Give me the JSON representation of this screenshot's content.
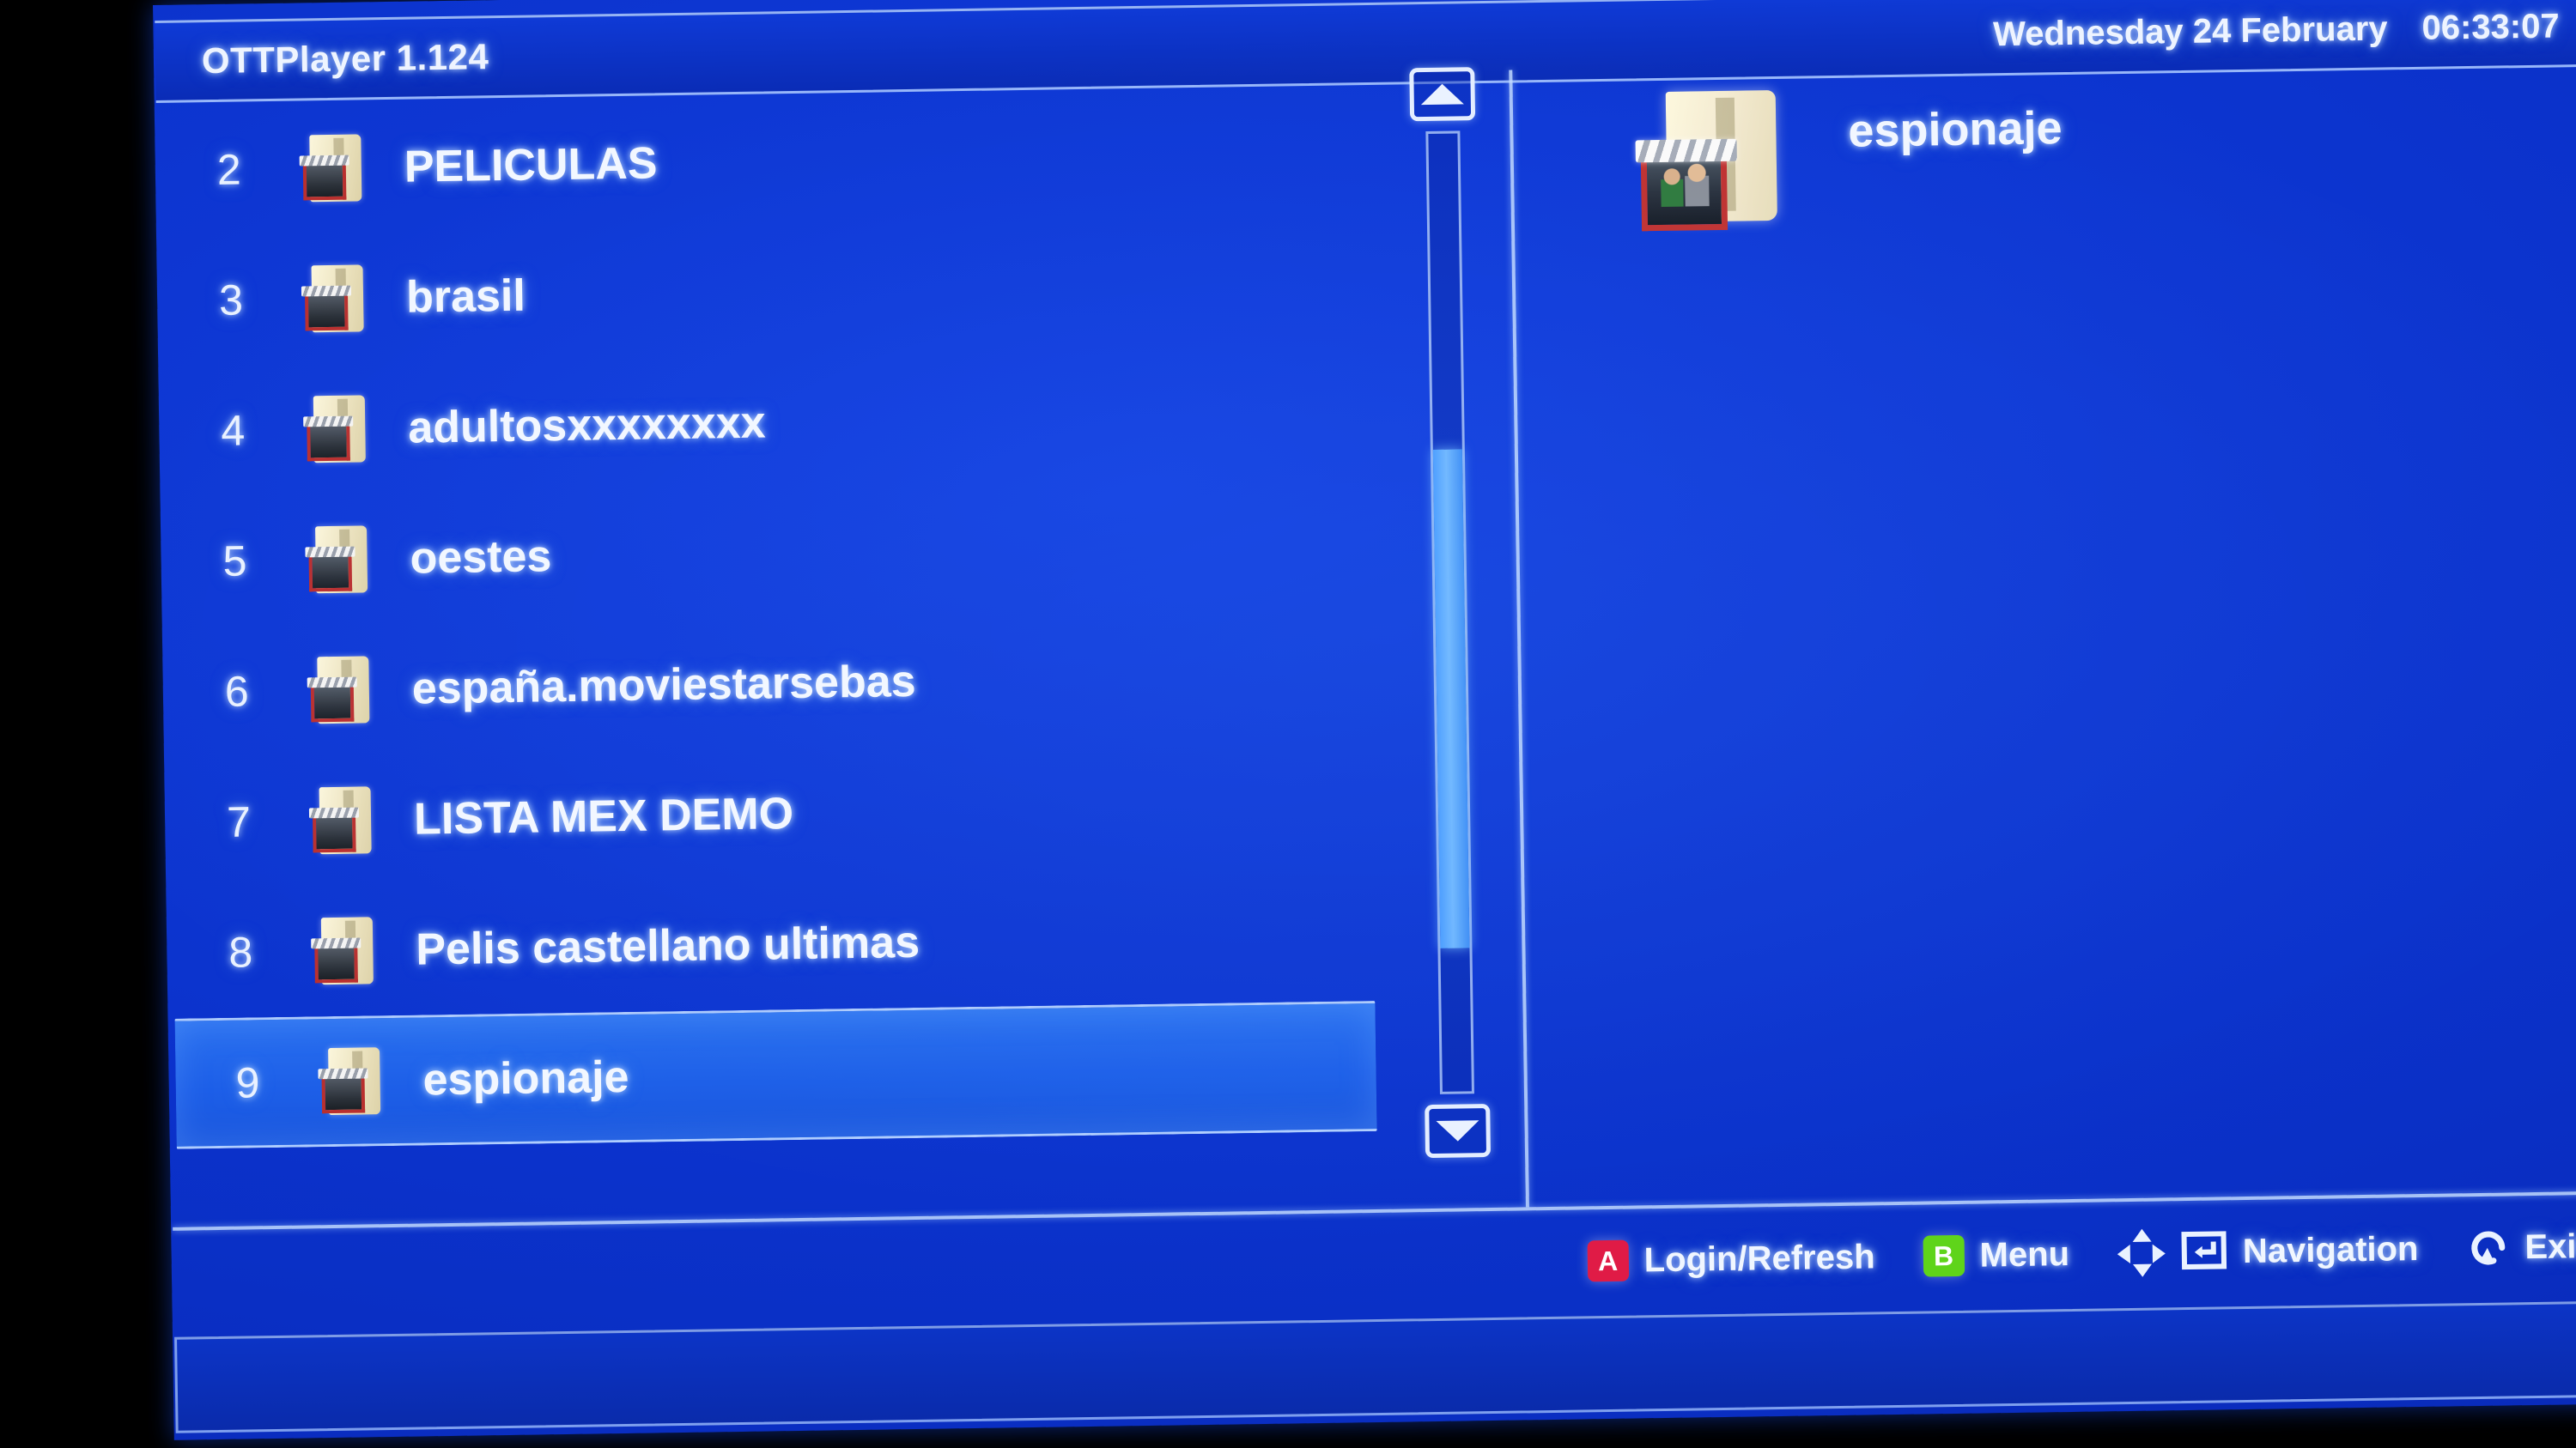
{
  "header": {
    "app_title": "OTTPlayer 1.124",
    "date": "Wednesday 24 February",
    "time": "06:33:07"
  },
  "list": {
    "items": [
      {
        "num": "2",
        "label": "PELICULAS",
        "icon": "folder-movie-icon",
        "selected": false
      },
      {
        "num": "3",
        "label": "brasil",
        "icon": "folder-movie-icon",
        "selected": false
      },
      {
        "num": "4",
        "label": "adultosxxxxxxxx",
        "icon": "folder-movie-icon",
        "selected": false
      },
      {
        "num": "5",
        "label": "oestes",
        "icon": "folder-movie-icon",
        "selected": false
      },
      {
        "num": "6",
        "label": "españa.moviestarsebas",
        "icon": "folder-movie-icon",
        "selected": false
      },
      {
        "num": "7",
        "label": "LISTA MEX DEMO",
        "icon": "folder-movie-icon",
        "selected": false
      },
      {
        "num": "8",
        "label": "Pelis castellano ultimas",
        "icon": "folder-movie-icon",
        "selected": false
      },
      {
        "num": "9",
        "label": "espionaje",
        "icon": "folder-movie-icon",
        "selected": true
      }
    ]
  },
  "scrollbar": {
    "up_icon": "scroll-up-arrow-icon",
    "down_icon": "scroll-down-arrow-icon"
  },
  "detail": {
    "label": "espionaje",
    "icon": "folder-movie-icon"
  },
  "footer": {
    "actions": [
      {
        "badge": "A",
        "badge_color": "#e01b46",
        "label": "Login/Refresh",
        "icon": "button-a-icon"
      },
      {
        "badge": "B",
        "badge_color": "#5fd41a",
        "label": "Menu",
        "icon": "button-b-icon"
      },
      {
        "badge": null,
        "badge_color": null,
        "label": "Navigation",
        "icon": "dpad-enter-icon"
      },
      {
        "badge": null,
        "badge_color": null,
        "label": "Exit",
        "icon": "back-arrow-icon"
      }
    ]
  },
  "colors": {
    "screen_bg": "#0b32cb",
    "accent_selected": "#2a70ef",
    "border": "#c3dcff",
    "text": "#f2f7ff",
    "badge_a": "#e01b46",
    "badge_b": "#5fd41a"
  }
}
